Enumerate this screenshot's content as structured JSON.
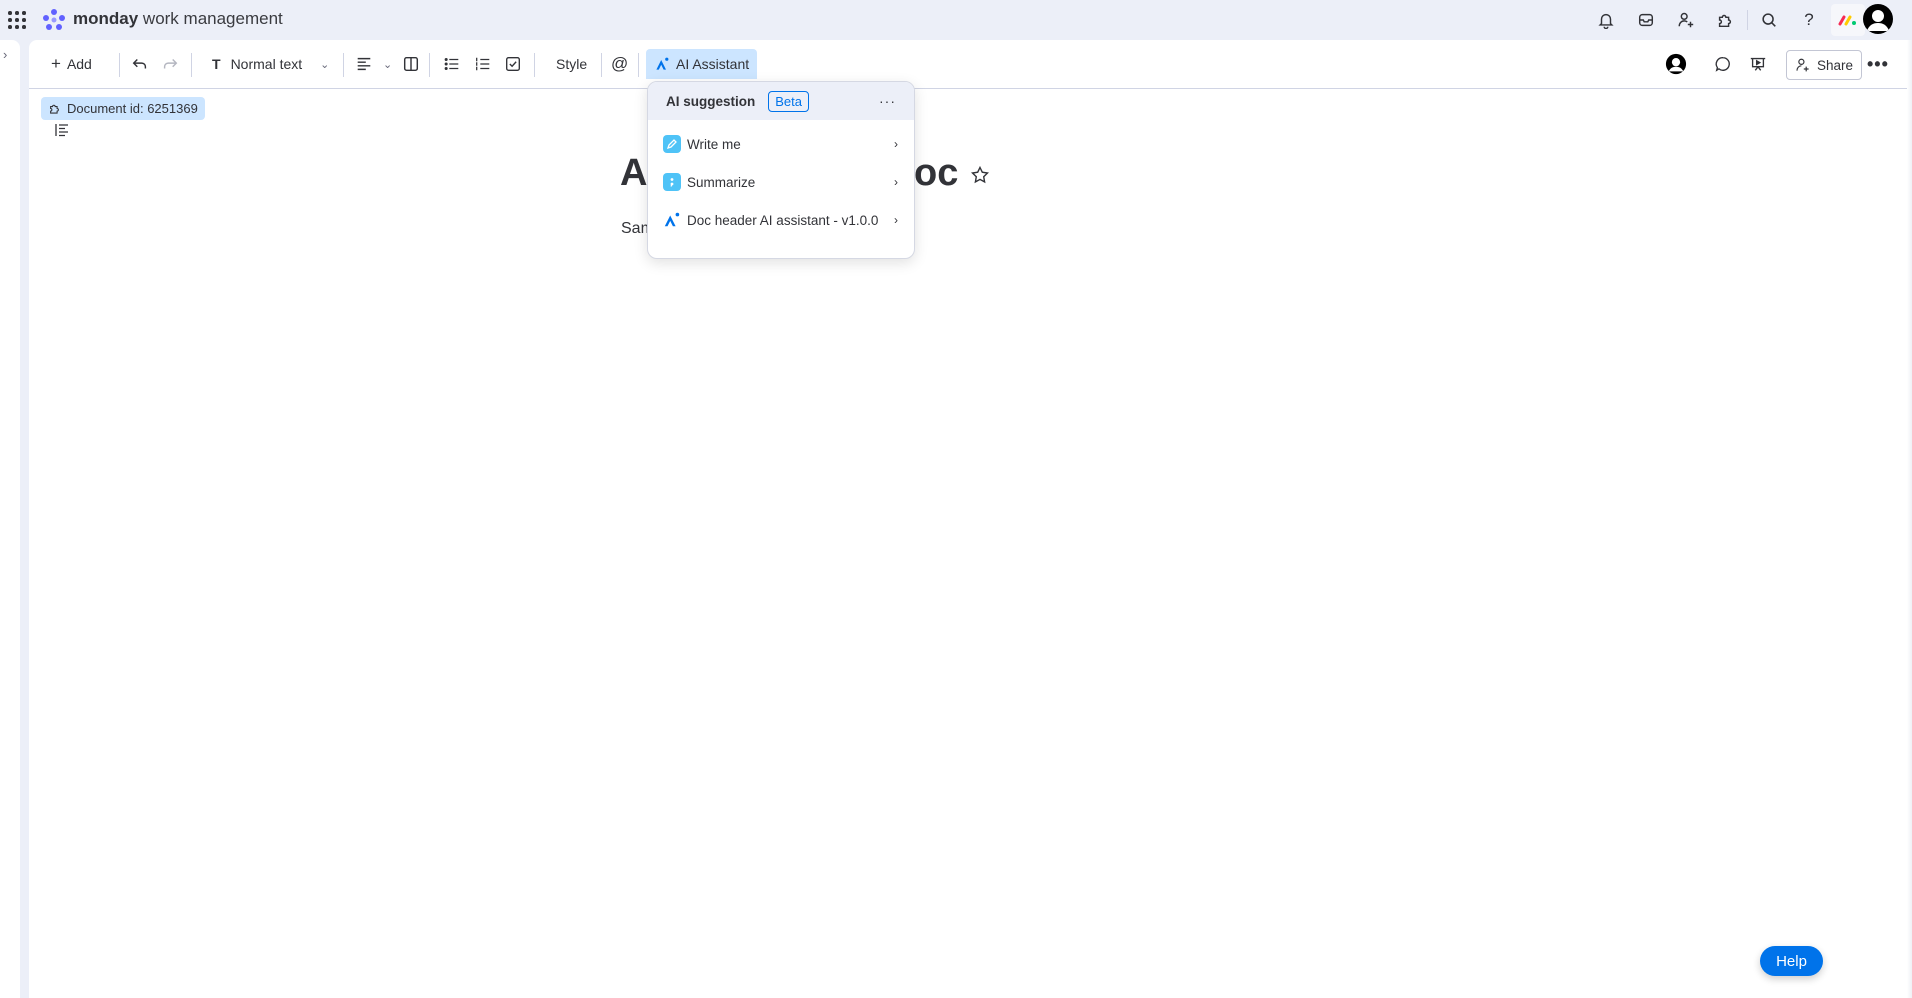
{
  "header": {
    "brand_bold": "monday",
    "brand_rest": " work management",
    "icons": [
      "apps-grid-icon",
      "notifications-icon",
      "inbox-icon",
      "invite-members-icon",
      "apps-marketplace-icon",
      "search-icon",
      "help-icon",
      "monday-logo-icon",
      "user-avatar"
    ]
  },
  "sidebar": {
    "toggle_icon": "chevron-right-icon"
  },
  "toolbar": {
    "add_label": "Add",
    "text_style": "Normal text",
    "style_label": "Style",
    "ai_assistant_label": "AI Assistant",
    "share_label": "Share"
  },
  "document": {
    "doc_id_label": "Document id: 6251369",
    "title_start": "A",
    "title_end": "oc",
    "subtitle_visible": "Sam"
  },
  "ai_menu": {
    "header_label": "AI suggestion",
    "badge": "Beta",
    "items": [
      {
        "label": "Write me",
        "icon": "pencil-icon",
        "color": "#4fc3f7"
      },
      {
        "label": "Summarize",
        "icon": "summarize-icon",
        "color": "#4fc3f7"
      },
      {
        "label": "Doc header AI assistant - v1.0.0",
        "icon": "ai-assistant-icon",
        "color": "#0073ea"
      }
    ]
  },
  "help_label": "Help",
  "colors": {
    "accent": "#0073ea",
    "highlight": "#cce5ff",
    "surface": "#eceff8"
  }
}
